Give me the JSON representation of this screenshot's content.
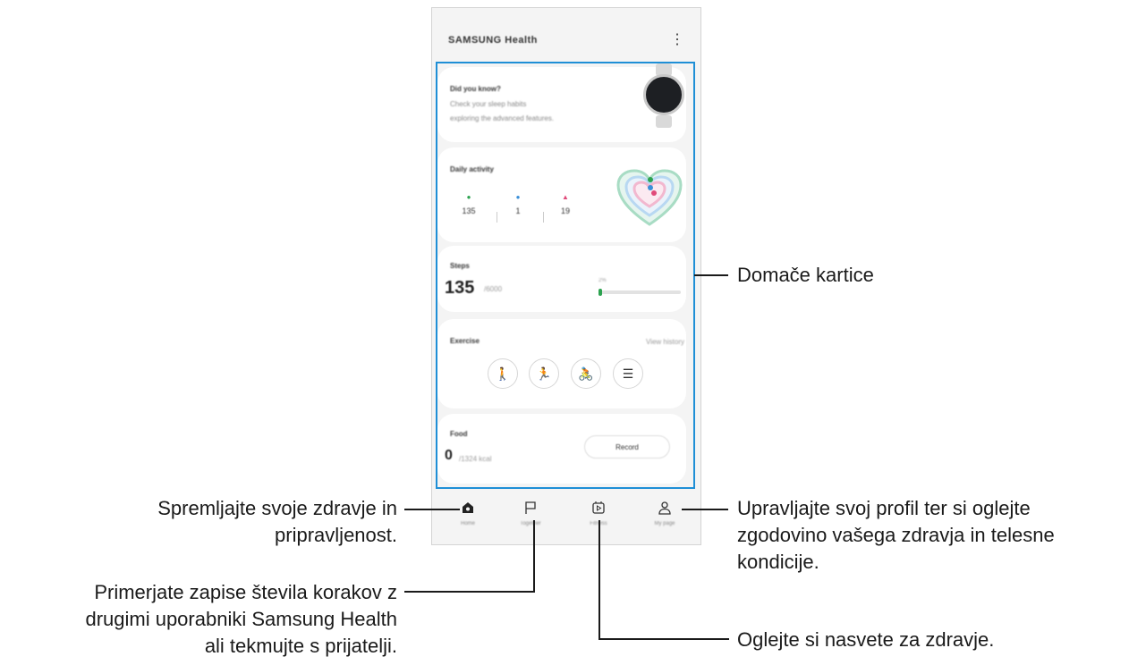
{
  "app": {
    "title": "SAMSUNG Health",
    "more_icon": "⋮"
  },
  "cards": {
    "tip": {
      "title": "Did you know?",
      "text_line1": "Check your sleep habits",
      "text_line2": "exploring the advanced features."
    },
    "daily_activity": {
      "title": "Daily activity",
      "stats": [
        {
          "icon": "steps-icon",
          "value": "135",
          "color": "#2ca24f"
        },
        {
          "icon": "active-time-icon",
          "value": "1",
          "color": "#3a8fd8"
        },
        {
          "icon": "calories-icon",
          "value": "19",
          "color": "#e04a7a"
        }
      ]
    },
    "steps": {
      "title": "Steps",
      "value": "135",
      "goal": "/6000",
      "percent": "2%",
      "progress": 0.02
    },
    "exercise": {
      "title": "Exercise",
      "view_history": "View history",
      "buttons": [
        {
          "name": "walking-icon",
          "glyph": "🚶"
        },
        {
          "name": "running-icon",
          "glyph": "🏃"
        },
        {
          "name": "cycling-icon",
          "glyph": "🚴"
        },
        {
          "name": "list-icon",
          "glyph": "☰"
        }
      ]
    },
    "food": {
      "title": "Food",
      "value": "0",
      "unit": "/1324 kcal",
      "record_label": "Record"
    }
  },
  "nav": [
    {
      "label": "Home",
      "icon": "home-icon"
    },
    {
      "label": "Together",
      "icon": "flag-icon"
    },
    {
      "label": "Fitness",
      "icon": "play-icon"
    },
    {
      "label": "My page",
      "icon": "person-icon"
    }
  ],
  "callouts": {
    "home_cards": "Domače kartice",
    "home_line1": "Spremljajte svoje zdravje in",
    "home_line2": "pripravljenost.",
    "together_line1": "Primerjate zapise števila korakov z",
    "together_line2": "drugimi uporabniki Samsung Health",
    "together_line3": "ali tekmujte s prijatelji.",
    "profile_line1": "Upravljajte svoj profil ter si oglejte",
    "profile_line2": "zgodovino vašega zdravja in telesne",
    "profile_line3": "kondicije.",
    "fitness": "Oglejte si nasvete za zdravje."
  },
  "colors": {
    "highlight": "#1f8fd6",
    "steps_green": "#2ca24f"
  }
}
